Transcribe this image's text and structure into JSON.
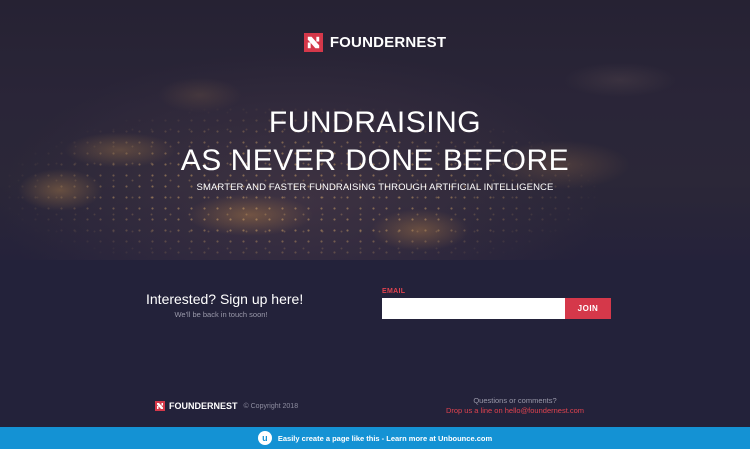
{
  "brand": {
    "name": "FOUNDERNEST",
    "mark_colors": [
      "#d5384a",
      "#ffffff"
    ]
  },
  "hero": {
    "title_line1": "FUNDRAISING",
    "title_line2": "AS NEVER DONE BEFORE",
    "subtitle": "SMARTER AND FASTER FUNDRAISING THROUGH ARTIFICIAL INTELLIGENCE"
  },
  "signup": {
    "heading": "Interested? Sign up here!",
    "note": "We'll be back in touch soon!",
    "email_label": "EMAIL",
    "email_value": "",
    "email_placeholder": "",
    "join_label": "JOIN"
  },
  "footer": {
    "brand_name": "FOUNDERNEST",
    "copyright": "© Copyright 2018",
    "contact_question": "Questions or comments?",
    "contact_line": "Drop us a line on hello@foundernest.com"
  },
  "unbounce": {
    "logo_glyph": "u",
    "text": "Easily create a page like this - Learn more at Unbounce.com"
  },
  "colors": {
    "accent": "#d5384a",
    "hero_bg": "#2a2538",
    "section_bg": "#23223a",
    "unbounce_blue": "#1492d4"
  }
}
